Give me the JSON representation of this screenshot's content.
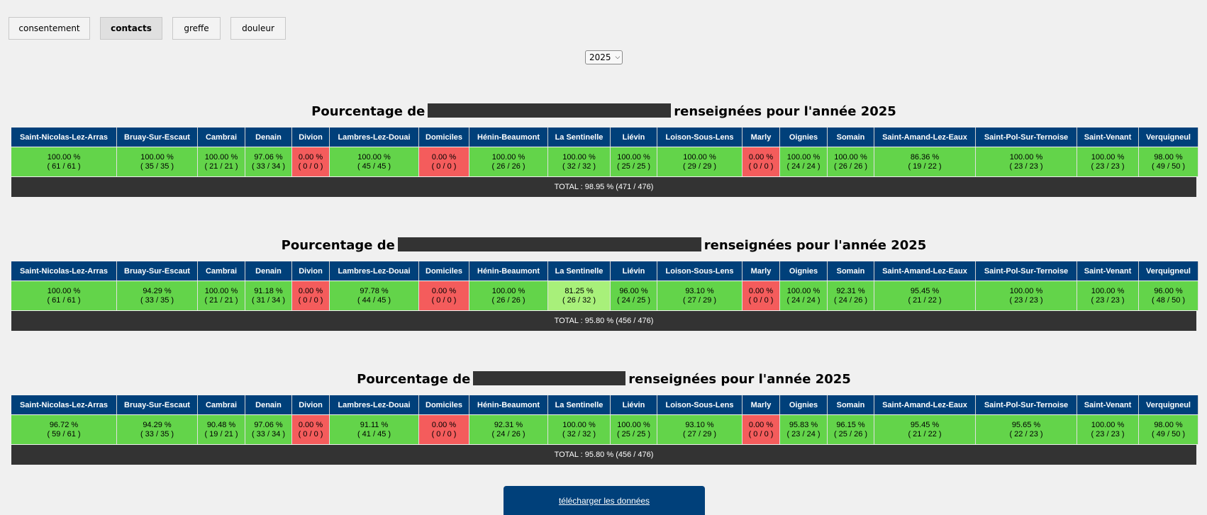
{
  "tabs": [
    {
      "label": "consentement",
      "active": false
    },
    {
      "label": "contacts",
      "active": true
    },
    {
      "label": "greffe",
      "active": false
    },
    {
      "label": "douleur",
      "active": false
    }
  ],
  "year_select": {
    "value": "2025"
  },
  "columns": [
    "Saint-Nicolas-Lez-Arras",
    "Bruay-Sur-Escaut",
    "Cambrai",
    "Denain",
    "Divion",
    "Lambres-Lez-Douai",
    "Domiciles",
    "Hénin-Beaumont",
    "La Sentinelle",
    "Liévin",
    "Loison-Sous-Lens",
    "Marly",
    "Oignies",
    "Somain",
    "Saint-Amand-Lez-Eaux",
    "Saint-Pol-Sur-Ternoise",
    "Saint-Venant",
    "Verquigneul"
  ],
  "colors": {
    "header": "#00407a",
    "ok": "#63d44a",
    "warn": "#a8f07a",
    "bad": "#f45c5c",
    "total": "#333333"
  },
  "sections": [
    {
      "title_prefix": "Pourcentage de",
      "title_suffix": "renseignées pour l'année 2025",
      "cells": [
        {
          "pct": "100.00 %",
          "count": "( 61 / 61 )",
          "status": "ok"
        },
        {
          "pct": "100.00 %",
          "count": "( 35 / 35 )",
          "status": "ok"
        },
        {
          "pct": "100.00 %",
          "count": "( 21 / 21 )",
          "status": "ok"
        },
        {
          "pct": "97.06 %",
          "count": "( 33 / 34 )",
          "status": "ok"
        },
        {
          "pct": "0.00 %",
          "count": "( 0 / 0 )",
          "status": "bad"
        },
        {
          "pct": "100.00 %",
          "count": "( 45 / 45 )",
          "status": "ok"
        },
        {
          "pct": "0.00 %",
          "count": "( 0 / 0 )",
          "status": "bad"
        },
        {
          "pct": "100.00 %",
          "count": "( 26 / 26 )",
          "status": "ok"
        },
        {
          "pct": "100.00 %",
          "count": "( 32 / 32 )",
          "status": "ok"
        },
        {
          "pct": "100.00 %",
          "count": "( 25 / 25 )",
          "status": "ok"
        },
        {
          "pct": "100.00 %",
          "count": "( 29 / 29 )",
          "status": "ok"
        },
        {
          "pct": "0.00 %",
          "count": "( 0 / 0 )",
          "status": "bad"
        },
        {
          "pct": "100.00 %",
          "count": "( 24 / 24 )",
          "status": "ok"
        },
        {
          "pct": "100.00 %",
          "count": "( 26 / 26 )",
          "status": "ok"
        },
        {
          "pct": "86.36 %",
          "count": "( 19 / 22 )",
          "status": "ok"
        },
        {
          "pct": "100.00 %",
          "count": "( 23 / 23 )",
          "status": "ok"
        },
        {
          "pct": "100.00 %",
          "count": "( 23 / 23 )",
          "status": "ok"
        },
        {
          "pct": "98.00 %",
          "count": "( 49 / 50 )",
          "status": "ok"
        }
      ],
      "total": "TOTAL : 98.95 % (471 / 476)"
    },
    {
      "title_prefix": "Pourcentage de",
      "title_suffix": "renseignées pour l'année 2025",
      "cells": [
        {
          "pct": "100.00 %",
          "count": "( 61 / 61 )",
          "status": "ok"
        },
        {
          "pct": "94.29 %",
          "count": "( 33 / 35 )",
          "status": "ok"
        },
        {
          "pct": "100.00 %",
          "count": "( 21 / 21 )",
          "status": "ok"
        },
        {
          "pct": "91.18 %",
          "count": "( 31 / 34 )",
          "status": "ok"
        },
        {
          "pct": "0.00 %",
          "count": "( 0 / 0 )",
          "status": "bad"
        },
        {
          "pct": "97.78 %",
          "count": "( 44 / 45 )",
          "status": "ok"
        },
        {
          "pct": "0.00 %",
          "count": "( 0 / 0 )",
          "status": "bad"
        },
        {
          "pct": "100.00 %",
          "count": "( 26 / 26 )",
          "status": "ok"
        },
        {
          "pct": "81.25 %",
          "count": "( 26 / 32 )",
          "status": "warn"
        },
        {
          "pct": "96.00 %",
          "count": "( 24 / 25 )",
          "status": "ok"
        },
        {
          "pct": "93.10 %",
          "count": "( 27 / 29 )",
          "status": "ok"
        },
        {
          "pct": "0.00 %",
          "count": "( 0 / 0 )",
          "status": "bad"
        },
        {
          "pct": "100.00 %",
          "count": "( 24 / 24 )",
          "status": "ok"
        },
        {
          "pct": "92.31 %",
          "count": "( 24 / 26 )",
          "status": "ok"
        },
        {
          "pct": "95.45 %",
          "count": "( 21 / 22 )",
          "status": "ok"
        },
        {
          "pct": "100.00 %",
          "count": "( 23 / 23 )",
          "status": "ok"
        },
        {
          "pct": "100.00 %",
          "count": "( 23 / 23 )",
          "status": "ok"
        },
        {
          "pct": "96.00 %",
          "count": "( 48 / 50 )",
          "status": "ok"
        }
      ],
      "total": "TOTAL : 95.80 % (456 / 476)"
    },
    {
      "title_prefix": "Pourcentage de",
      "title_suffix": "renseignées pour l'année 2025",
      "cells": [
        {
          "pct": "96.72 %",
          "count": "( 59 / 61 )",
          "status": "ok"
        },
        {
          "pct": "94.29 %",
          "count": "( 33 / 35 )",
          "status": "ok"
        },
        {
          "pct": "90.48 %",
          "count": "( 19 / 21 )",
          "status": "ok"
        },
        {
          "pct": "97.06 %",
          "count": "( 33 / 34 )",
          "status": "ok"
        },
        {
          "pct": "0.00 %",
          "count": "( 0 / 0 )",
          "status": "bad"
        },
        {
          "pct": "91.11 %",
          "count": "( 41 / 45 )",
          "status": "ok"
        },
        {
          "pct": "0.00 %",
          "count": "( 0 / 0 )",
          "status": "bad"
        },
        {
          "pct": "92.31 %",
          "count": "( 24 / 26 )",
          "status": "ok"
        },
        {
          "pct": "100.00 %",
          "count": "( 32 / 32 )",
          "status": "ok"
        },
        {
          "pct": "100.00 %",
          "count": "( 25 / 25 )",
          "status": "ok"
        },
        {
          "pct": "93.10 %",
          "count": "( 27 / 29 )",
          "status": "ok"
        },
        {
          "pct": "0.00 %",
          "count": "( 0 / 0 )",
          "status": "bad"
        },
        {
          "pct": "95.83 %",
          "count": "( 23 / 24 )",
          "status": "ok"
        },
        {
          "pct": "96.15 %",
          "count": "( 25 / 26 )",
          "status": "ok"
        },
        {
          "pct": "95.45 %",
          "count": "( 21 / 22 )",
          "status": "ok"
        },
        {
          "pct": "95.65 %",
          "count": "( 22 / 23 )",
          "status": "ok"
        },
        {
          "pct": "100.00 %",
          "count": "( 23 / 23 )",
          "status": "ok"
        },
        {
          "pct": "98.00 %",
          "count": "( 49 / 50 )",
          "status": "ok"
        }
      ],
      "total": "TOTAL : 95.80 % (456 / 476)"
    }
  ],
  "download_label": "télécharger les données"
}
